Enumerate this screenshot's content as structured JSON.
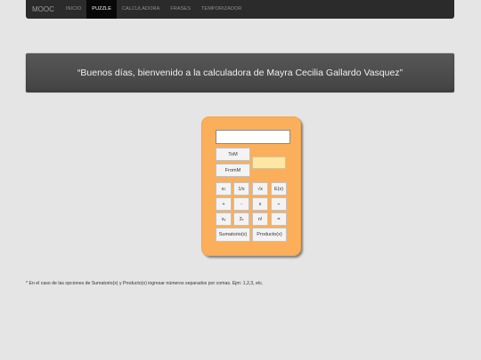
{
  "nav": {
    "brand": "MOOC",
    "items": [
      "INICIO",
      "PUZZLE",
      "CALCULADORA",
      "FRASES",
      "TEMPORIZADOR"
    ],
    "active": "PUZZLE"
  },
  "banner": {
    "text": "“Buenos días, bienvenido a la calculadora de Mayra Cecilia Gallardo Vasquez”"
  },
  "calculator": {
    "display_value": "",
    "result_value": "",
    "buttons": {
      "tom": "ToM",
      "fromm": "FromM",
      "square_base": "x",
      "square_exp": "2",
      "reciprocal": "1/x",
      "sqrt": "√x",
      "e_power": "E(x)",
      "plus": "+",
      "minus": "-",
      "times": "x",
      "divide": "÷",
      "power_base": "x",
      "power_exp": "y",
      "two_power_base": "2",
      "two_power_exp": "x",
      "factorial": "n!",
      "equals": "=",
      "sumatorio": "Sumatorio(x)",
      "producto": "Producto(x)"
    }
  },
  "footnote": "* En el caso de las opciones de Sumatorio(x) y Producto(x) ingresar números separados por comas. Ejm: 1,2,3, etc.",
  "colors": {
    "navbar": "#2b2b2b",
    "banner": "#4d4d4d",
    "calculator_body": "#fbaf5a",
    "result_field": "#fce7a4"
  }
}
